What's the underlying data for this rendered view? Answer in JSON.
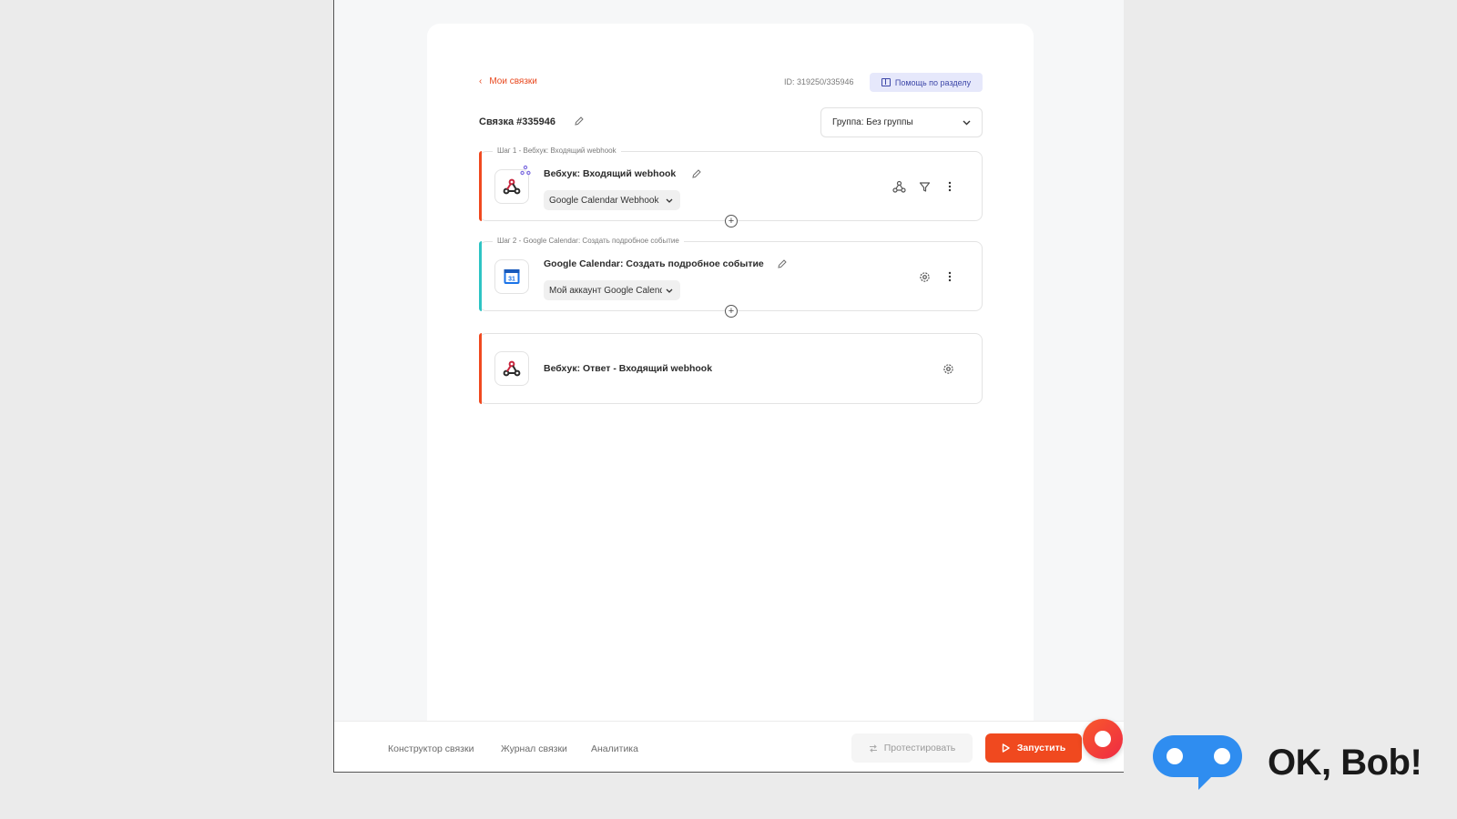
{
  "header": {
    "back_label": "Мои связки",
    "id_text": "ID: 319250/335946",
    "help_label": "Помощь по разделу"
  },
  "link": {
    "title": "Связка #335946",
    "group_label": "Группа: Без группы"
  },
  "steps": [
    {
      "caption": "Шаг 1 - Вебхук: Входящий webhook",
      "name": "Вебхук: Входящий webhook",
      "account": "Google Calendar Webhook",
      "accent": "#f0491f",
      "icon": "webhook-icon"
    },
    {
      "caption": "Шаг 2 - Google Calendar: Создать подробное событие",
      "name": "Google Calendar: Создать подробное событие",
      "account": "Мой аккаунт Google Calendar",
      "accent": "#2ec4c4",
      "icon": "google-calendar-icon",
      "calendar_day": "31"
    },
    {
      "name": "Вебхук: Ответ - Входящий webhook",
      "accent": "#f0491f",
      "icon": "webhook-icon"
    }
  ],
  "bottom_tabs": [
    "Конструктор связки",
    "Журнал связки",
    "Аналитика"
  ],
  "actions": {
    "test_label": "Протестировать",
    "run_label": "Запустить"
  },
  "brand": {
    "text": "OK, Bob!",
    "color": "#2f8df0"
  }
}
